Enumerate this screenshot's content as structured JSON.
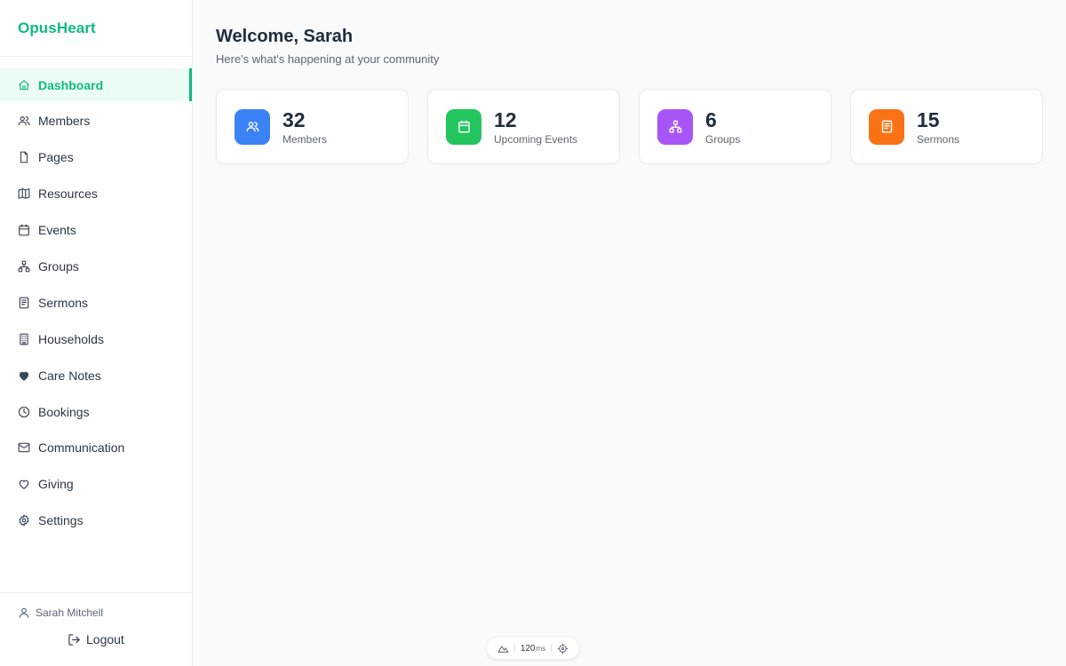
{
  "brand": "OpusHeart",
  "colors": {
    "accent": "#10b981",
    "members": "#3b82f6",
    "events": "#22c55e",
    "groups": "#a855f7",
    "sermons": "#f97316"
  },
  "sidebar": {
    "items": [
      {
        "label": "Dashboard",
        "icon": "home-icon",
        "active": true
      },
      {
        "label": "Members",
        "icon": "users-icon"
      },
      {
        "label": "Pages",
        "icon": "file-icon"
      },
      {
        "label": "Resources",
        "icon": "map-icon"
      },
      {
        "label": "Events",
        "icon": "calendar-icon"
      },
      {
        "label": "Groups",
        "icon": "network-icon"
      },
      {
        "label": "Sermons",
        "icon": "book-icon"
      },
      {
        "label": "Households",
        "icon": "building-icon"
      },
      {
        "label": "Care Notes",
        "icon": "heart-filled-icon"
      },
      {
        "label": "Bookings",
        "icon": "clock-icon"
      },
      {
        "label": "Communication",
        "icon": "mail-icon"
      },
      {
        "label": "Giving",
        "icon": "heart-icon"
      },
      {
        "label": "Settings",
        "icon": "gear-icon"
      }
    ],
    "user_name": "Sarah Mitchell",
    "logout_label": "Logout"
  },
  "main": {
    "title": "Welcome, Sarah",
    "subtitle": "Here's what's happening at your community",
    "stats": [
      {
        "value": "32",
        "label": "Members",
        "icon": "users-icon"
      },
      {
        "value": "12",
        "label": "Upcoming Events",
        "icon": "calendar-icon"
      },
      {
        "value": "6",
        "label": "Groups",
        "icon": "network-icon"
      },
      {
        "value": "15",
        "label": "Sermons",
        "icon": "book-icon"
      }
    ]
  },
  "devbar": {
    "value": "120",
    "unit": "ms"
  }
}
